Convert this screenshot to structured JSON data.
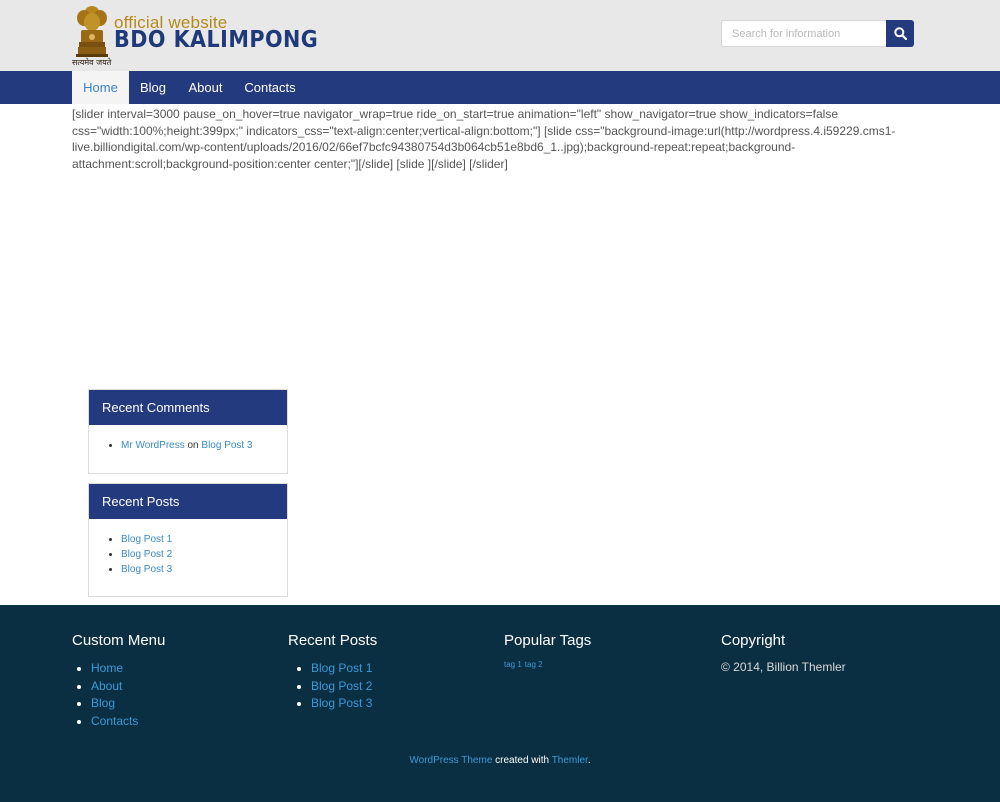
{
  "header": {
    "logo_official": "official website",
    "logo_name": "BDO KALIMPONG",
    "logo_motto": "सत्यमेव जयते",
    "search_placeholder": "Search for information"
  },
  "nav": {
    "items": [
      {
        "label": "Home",
        "active": true
      },
      {
        "label": "Blog",
        "active": false
      },
      {
        "label": "About",
        "active": false
      },
      {
        "label": "Contacts",
        "active": false
      }
    ]
  },
  "main": {
    "shortcode_text": "[slider interval=3000 pause_on_hover=true navigator_wrap=true ride_on_start=true animation=\"left\" show_navigator=true show_indicators=false css=\"width:100%;height:399px;\" indicators_css=\"text-align:center;vertical-align:bottom;\"] [slide css=\"background-image:url(http://wordpress.4.i59229.cms1-live.billiondigital.com/wp-content/uploads/2016/02/66ef7bcfc94380754d3b064cb51e8bd6_1..jpg);background-repeat:repeat;background-attachment:scroll;background-position:center center;\"][/slide] [slide ][/slide] [/slider]"
  },
  "sidebar": {
    "recent_comments": {
      "title": "Recent Comments",
      "author": "Mr WordPress",
      "on_text": " on ",
      "post": "Blog Post 3"
    },
    "recent_posts": {
      "title": "Recent Posts",
      "items": [
        "Blog Post 1",
        "Blog Post 2",
        "Blog Post 3"
      ]
    }
  },
  "footer": {
    "custom_menu": {
      "title": "Custom Menu",
      "items": [
        "Home",
        "About",
        "Blog",
        "Contacts"
      ]
    },
    "recent_posts": {
      "title": "Recent Posts",
      "items": [
        "Blog Post 1",
        "Blog Post 2",
        "Blog Post 3"
      ]
    },
    "popular_tags": {
      "title": "Popular Tags",
      "tags": [
        "tag 1",
        "tag 2"
      ]
    },
    "copyright": {
      "title": "Copyright",
      "text": "© 2014, Billion Themler"
    },
    "credit": {
      "theme_link": "WordPress Theme",
      "middle": " created with ",
      "themler_link": "Themler",
      "end": "."
    }
  },
  "colors": {
    "header_bg": "#e8e8e8",
    "nav_bg": "#243a7e",
    "footer_bg": "#0b2f42",
    "link": "#3a8ac4",
    "logo_gold": "#b58a1a",
    "logo_blue": "#1f3a7a"
  }
}
